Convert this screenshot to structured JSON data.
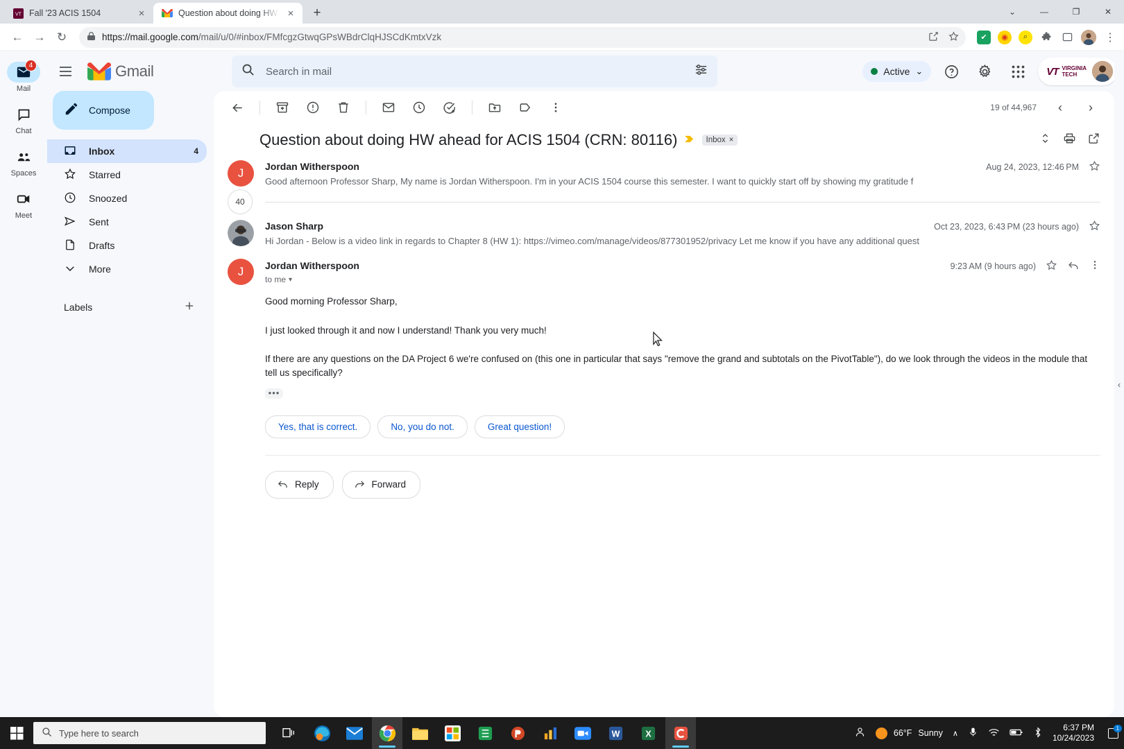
{
  "browser": {
    "tabs": [
      {
        "title": "Fall '23 ACIS 1504",
        "favicon": "vt-icon",
        "active": false,
        "close_label": "×"
      },
      {
        "title": "Question about doing HW ahea",
        "favicon": "gmail-icon",
        "active": true,
        "close_label": "×"
      }
    ],
    "new_tab_label": "+",
    "window_controls": {
      "minimize": "—",
      "maximize": "❐",
      "close": "✕",
      "restore_chevron": "⌄"
    },
    "nav": {
      "back": "←",
      "forward": "→",
      "reload": "↻"
    },
    "omnibox": {
      "lock_icon": "lock-icon",
      "url_prefix": "https://mail.google.com",
      "url_path": "/mail/u/0/#inbox/FMfcgzGtwqGPsWBdrClqHJSCdKmtxVzk",
      "share_icon": "share-icon",
      "bookmark_icon": "star-icon"
    },
    "extensions": [
      {
        "name": "checkmark-extension-icon",
        "glyph": "✔",
        "bg": "#1aa260",
        "fg": "#ffffff"
      },
      {
        "name": "honey-extension-icon",
        "glyph": "◉",
        "bg": "#ffd400",
        "fg": "#d93025"
      },
      {
        "name": "search-extension-icon",
        "glyph": "⌕",
        "bg": "#ffe300",
        "fg": "#3c4043"
      },
      {
        "name": "puzzle-extension-icon",
        "glyph": "⚙",
        "bg": "transparent",
        "fg": "#5f6368"
      },
      {
        "name": "sidepanel-icon",
        "glyph": "□",
        "bg": "transparent",
        "fg": "#5f6368"
      }
    ],
    "profile_name": "profile-avatar",
    "menu_icon": "⋮"
  },
  "gmail": {
    "rail": [
      {
        "label": "Mail",
        "icon": "mail-icon",
        "badge": "4",
        "active": true
      },
      {
        "label": "Chat",
        "icon": "chat-icon",
        "badge": "",
        "active": false
      },
      {
        "label": "Spaces",
        "icon": "spaces-icon",
        "badge": "",
        "active": false
      },
      {
        "label": "Meet",
        "icon": "meet-icon",
        "badge": "",
        "active": false
      }
    ],
    "logo_text": "Gmail",
    "search": {
      "placeholder": "Search in mail",
      "value": "",
      "icon": "search-icon",
      "options_icon": "tune-icon"
    },
    "status_chip": {
      "label": "Active",
      "chevron": "⌄",
      "dot_color": "#0b8043"
    },
    "header_icons": [
      {
        "name": "help-icon",
        "glyph": "?"
      },
      {
        "name": "settings-gear-icon",
        "glyph": "⚙"
      },
      {
        "name": "google-apps-icon",
        "glyph": "⁙"
      }
    ],
    "org_badge": {
      "mark": "VT",
      "line1": "VIRGINIA",
      "line2": "TECH"
    },
    "compose": {
      "label": "Compose",
      "icon": "pencil-icon"
    },
    "nav_items": [
      {
        "label": "Inbox",
        "icon": "inbox-icon",
        "count": "4",
        "selected": true
      },
      {
        "label": "Starred",
        "icon": "star-icon",
        "count": "",
        "selected": false
      },
      {
        "label": "Snoozed",
        "icon": "clock-icon",
        "count": "",
        "selected": false
      },
      {
        "label": "Sent",
        "icon": "send-icon",
        "count": "",
        "selected": false
      },
      {
        "label": "Drafts",
        "icon": "draft-icon",
        "count": "",
        "selected": false
      },
      {
        "label": "More",
        "icon": "chevron-down-icon",
        "count": "",
        "selected": false
      }
    ],
    "labels": {
      "title": "Labels",
      "add_icon": "plus-icon"
    },
    "toolbar": {
      "back": "back-arrow-icon",
      "icons": [
        {
          "name": "archive-icon"
        },
        {
          "name": "report-spam-icon"
        },
        {
          "name": "delete-icon"
        },
        {
          "name": "mark-unread-icon"
        },
        {
          "name": "snooze-icon"
        },
        {
          "name": "add-to-tasks-icon"
        },
        {
          "name": "move-to-icon"
        },
        {
          "name": "labels-icon"
        },
        {
          "name": "more-options-icon"
        }
      ],
      "pagination": {
        "count_text": "19 of 44,967",
        "prev": "‹",
        "next": "›"
      }
    },
    "thread": {
      "subject": "Question about doing HW ahead for ACIS 1504 (CRN: 80116)",
      "important_marker": "important-marker-icon",
      "label_chip": {
        "text": "Inbox",
        "remove": "×"
      },
      "actions": [
        {
          "name": "expand-all-icon"
        },
        {
          "name": "print-icon"
        },
        {
          "name": "open-in-new-window-icon"
        }
      ],
      "messages": [
        {
          "sender": "Jordan Witherspoon",
          "avatar_letter": "J",
          "avatar_type": "letter",
          "date": "Aug 24, 2023, 12:46 PM",
          "snippet": "Good afternoon Professor Sharp, My name is Jordan Witherspoon. I'm in your ACIS 1504 course this semester. I want to quickly start off by showing my gratitude f",
          "collapsed": true,
          "star_icon": "star-icon"
        },
        {
          "sender": "Jason Sharp",
          "avatar_letter": "",
          "avatar_type": "photo",
          "date": "Oct 23, 2023, 6:43 PM (23 hours ago)",
          "snippet": "Hi Jordan - Below is a video link in regards to Chapter 8 (HW 1): https://vimeo.com/manage/videos/877301952/privacy Let me know if you have any additional quest",
          "collapsed": true,
          "star_icon": "star-icon"
        },
        {
          "sender": "Jordan Witherspoon",
          "avatar_letter": "J",
          "avatar_type": "letter",
          "date": "9:23 AM (9 hours ago)",
          "to_line": "to me",
          "to_chevron": "▾",
          "collapsed": false,
          "star_icon": "star-icon",
          "reply_icon": "reply-icon",
          "more_icon": "more-options-icon",
          "body": [
            "Good morning Professor Sharp,",
            "I just looked through it and now I understand! Thank you very much!",
            "If there are any questions on the DA Project 6 we're confused on (this one in particular that says \"remove the grand and subtotals on the PivotTable\"), do we look through the videos in the module that tell us specifically?"
          ],
          "trimmed_content_label": "•••"
        }
      ],
      "collapsed_count": "40",
      "smart_replies": [
        "Yes, that is correct.",
        "No, you do not.",
        "Great question!"
      ],
      "reply_button": {
        "label": "Reply",
        "icon": "reply-icon"
      },
      "forward_button": {
        "label": "Forward",
        "icon": "forward-icon"
      }
    },
    "side_panel_arrow": "‹"
  },
  "taskbar": {
    "start_icon": "windows-start-icon",
    "search": {
      "placeholder": "Type here to search",
      "icon": "search-icon"
    },
    "task_view_icon": "task-view-icon",
    "apps": [
      {
        "name": "edge-taskbar-icon",
        "running": false
      },
      {
        "name": "mail-taskbar-icon",
        "running": false
      },
      {
        "name": "chrome-taskbar-icon",
        "running": true
      },
      {
        "name": "file-explorer-taskbar-icon",
        "running": false
      },
      {
        "name": "store-taskbar-icon",
        "running": false
      },
      {
        "name": "excel-green-taskbar-icon",
        "running": false
      },
      {
        "name": "powerpoint-taskbar-icon",
        "running": false
      },
      {
        "name": "charts-taskbar-icon",
        "running": false
      },
      {
        "name": "zoom-taskbar-icon",
        "running": false
      },
      {
        "name": "word-taskbar-icon",
        "running": false
      },
      {
        "name": "excel-taskbar-icon",
        "running": false
      },
      {
        "name": "camtasia-taskbar-icon",
        "running": true
      }
    ],
    "tray": {
      "people_icon": "people-icon",
      "weather": {
        "temp": "66°F",
        "condition": "Sunny",
        "icon": "sun-icon"
      },
      "chevron_up": "∧",
      "icons": [
        {
          "name": "microphone-icon"
        },
        {
          "name": "wifi-icon"
        },
        {
          "name": "battery-icon"
        },
        {
          "name": "bluetooth-icon"
        }
      ],
      "time": "6:37 PM",
      "date": "10/24/2023",
      "notification_count": "1"
    }
  }
}
